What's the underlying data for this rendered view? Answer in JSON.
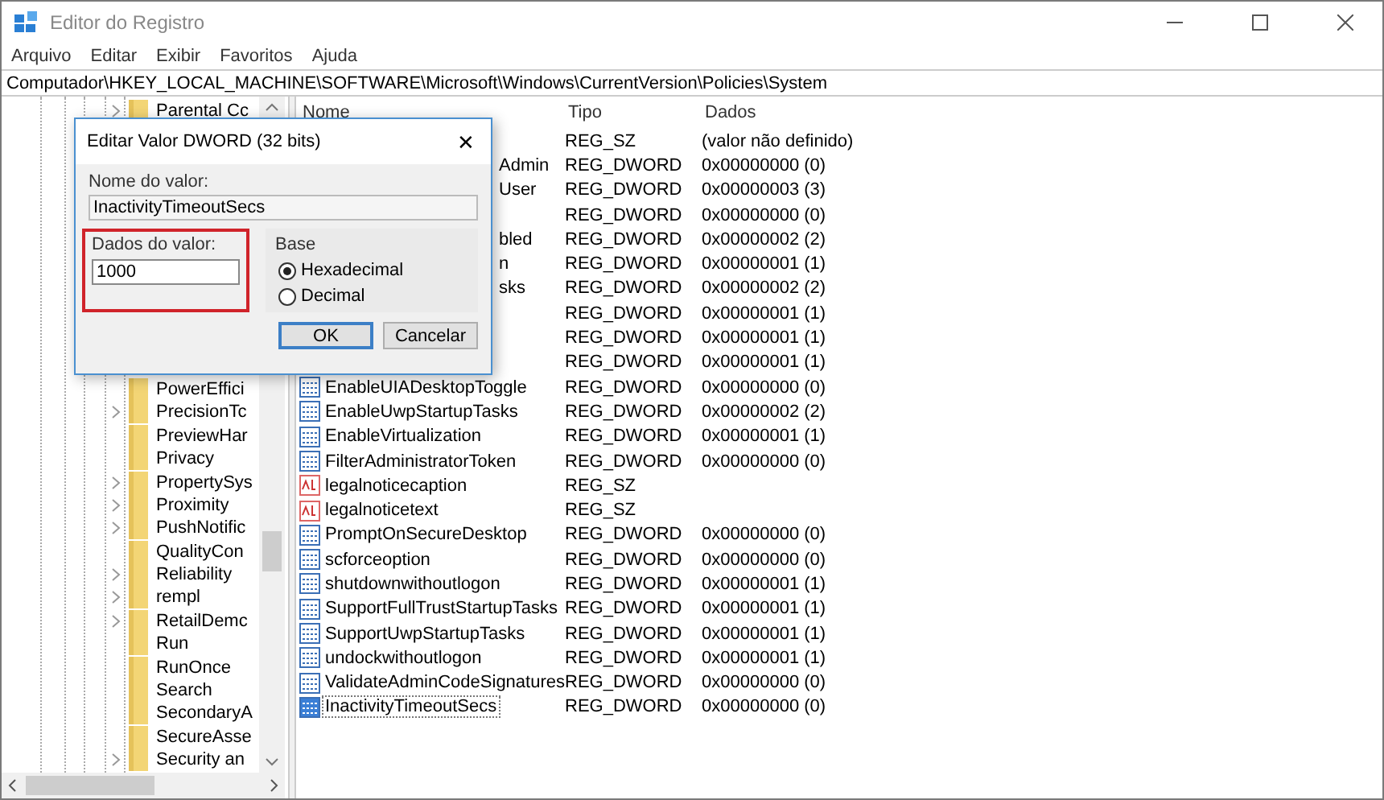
{
  "window": {
    "title": "Editor do Registro"
  },
  "menu": [
    "Arquivo",
    "Editar",
    "Exibir",
    "Favoritos",
    "Ajuda"
  ],
  "address": "Computador\\HKEY_LOCAL_MACHINE\\SOFTWARE\\Microsoft\\Windows\\CurrentVersion\\Policies\\System",
  "tree": {
    "items_top": [
      {
        "label": "Parental Cc",
        "expandable": true
      }
    ],
    "items": [
      {
        "label": "PowerEffici",
        "expandable": false
      },
      {
        "label": "PrecisionTc",
        "expandable": true
      },
      {
        "label": "PreviewHar",
        "expandable": false
      },
      {
        "label": "Privacy",
        "expandable": false
      },
      {
        "label": "PropertySys",
        "expandable": true
      },
      {
        "label": "Proximity",
        "expandable": true
      },
      {
        "label": "PushNotific",
        "expandable": true
      },
      {
        "label": "QualityCon",
        "expandable": false
      },
      {
        "label": "Reliability",
        "expandable": true
      },
      {
        "label": "rempl",
        "expandable": true
      },
      {
        "label": "RetailDemc",
        "expandable": true
      },
      {
        "label": "Run",
        "expandable": false
      },
      {
        "label": "RunOnce",
        "expandable": false
      },
      {
        "label": "Search",
        "expandable": false
      },
      {
        "label": "SecondaryA",
        "expandable": false
      },
      {
        "label": "SecureAsse",
        "expandable": false
      },
      {
        "label": "Security an",
        "expandable": true
      }
    ]
  },
  "table": {
    "columns": [
      "Nome",
      "Tipo",
      "Dados"
    ],
    "rows": [
      {
        "tipo": "REG_SZ",
        "dados": "(valor não definido)"
      },
      {
        "name": "Admin",
        "tipo": "REG_DWORD",
        "dados": "0x00000000 (0)"
      },
      {
        "name": "User",
        "tipo": "REG_DWORD",
        "dados": "0x00000003 (3)"
      },
      {
        "tipo": "REG_DWORD",
        "dados": "0x00000000 (0)"
      },
      {
        "name": "bled",
        "tipo": "REG_DWORD",
        "dados": "0x00000002 (2)"
      },
      {
        "name": "n",
        "tipo": "REG_DWORD",
        "dados": "0x00000001 (1)"
      },
      {
        "name": "sks",
        "tipo": "REG_DWORD",
        "dados": "0x00000002 (2)"
      },
      {
        "tipo": "REG_DWORD",
        "dados": "0x00000001 (1)"
      },
      {
        "tipo": "REG_DWORD",
        "dados": "0x00000001 (1)"
      },
      {
        "tipo": "REG_DWORD",
        "dados": "0x00000001 (1)"
      },
      {
        "name": "EnableUIADesktopToggle",
        "kind": "binary",
        "tipo": "REG_DWORD",
        "dados": "0x00000000 (0)",
        "selected": false
      },
      {
        "name": "EnableUwpStartupTasks",
        "kind": "binary",
        "tipo": "REG_DWORD",
        "dados": "0x00000002 (2)",
        "selected": false
      },
      {
        "name": "EnableVirtualization",
        "kind": "binary",
        "tipo": "REG_DWORD",
        "dados": "0x00000001 (1)",
        "selected": false
      },
      {
        "name": "FilterAdministratorToken",
        "kind": "binary",
        "tipo": "REG_DWORD",
        "dados": "0x00000000 (0)",
        "selected": false
      },
      {
        "name": "legalnoticecaption",
        "kind": "string",
        "tipo": "REG_SZ",
        "selected": false
      },
      {
        "name": "legalnoticetext",
        "kind": "string",
        "tipo": "REG_SZ",
        "selected": false
      },
      {
        "name": "PromptOnSecureDesktop",
        "kind": "binary",
        "tipo": "REG_DWORD",
        "dados": "0x00000000 (0)",
        "selected": false
      },
      {
        "name": "scforceoption",
        "kind": "binary",
        "tipo": "REG_DWORD",
        "dados": "0x00000000 (0)",
        "selected": false
      },
      {
        "name": "shutdownwithoutlogon",
        "kind": "binary",
        "tipo": "REG_DWORD",
        "dados": "0x00000001 (1)",
        "selected": false
      },
      {
        "name": "SupportFullTrustStartupTasks",
        "kind": "binary",
        "tipo": "REG_DWORD",
        "dados": "0x00000001 (1)",
        "selected": false
      },
      {
        "name": "SupportUwpStartupTasks",
        "kind": "binary",
        "tipo": "REG_DWORD",
        "dados": "0x00000001 (1)",
        "selected": false
      },
      {
        "name": "undockwithoutlogon",
        "kind": "binary",
        "tipo": "REG_DWORD",
        "dados": "0x00000001 (1)",
        "selected": false
      },
      {
        "name": "ValidateAdminCodeSignatures",
        "kind": "binary",
        "tipo": "REG_DWORD",
        "dados": "0x00000000 (0)",
        "selected": false
      },
      {
        "name": "InactivityTimeoutSecs",
        "kind": "binary",
        "tipo": "REG_DWORD",
        "dados": "0x00000000 (0)",
        "selected": true
      }
    ]
  },
  "dialog": {
    "title": "Editar Valor DWORD (32 bits)",
    "close": "✕",
    "name_label": "Nome do valor:",
    "name_value": "InactivityTimeoutSecs",
    "data_label": "Dados do valor:",
    "data_value": "1000",
    "data_highlighted": true,
    "base_label": "Base",
    "base_options": [
      {
        "label": "Hexadecimal",
        "selected": true
      },
      {
        "label": "Decimal",
        "selected": false
      }
    ],
    "buttons": [
      {
        "label": "OK",
        "default": true
      },
      {
        "label": "Cancelar",
        "default": false
      }
    ]
  }
}
